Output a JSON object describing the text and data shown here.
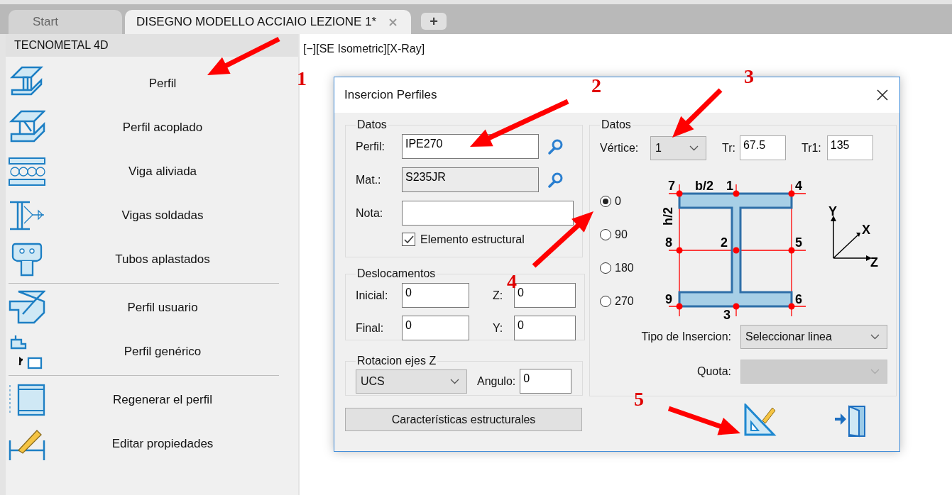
{
  "tabs": [
    {
      "label": "Start",
      "selected": false
    },
    {
      "label": "DISEGNO MODELLO ACCIAIO LEZIONE 1*",
      "selected": true
    }
  ],
  "new_tab": "+",
  "panel": {
    "title": "TECNOMETAL 4D",
    "groups": [
      [
        {
          "label": "Perfil",
          "kind": "beam"
        },
        {
          "label": "Perfil acoplado",
          "kind": "double"
        },
        {
          "label": "Viga aliviada",
          "kind": "castellated"
        },
        {
          "label": "Vigas soldadas",
          "kind": "welded"
        },
        {
          "label": "Tubos aplastados",
          "kind": "tube"
        }
      ],
      [
        {
          "label": "Perfil usuario",
          "kind": "user"
        },
        {
          "label": "Perfil genérico",
          "kind": "generic"
        }
      ],
      [
        {
          "label": "Regenerar el perfil",
          "kind": "regen"
        },
        {
          "label": "Editar propiedades",
          "kind": "edit"
        }
      ]
    ]
  },
  "viewport": {
    "label": "[−][SE Isometric][X-Ray]"
  },
  "dialog": {
    "title": "Insercion Perfiles",
    "datos": {
      "legend": "Datos",
      "perfil": {
        "label": "Perfil:",
        "value": "IPE270"
      },
      "material": {
        "label": "Mat.:",
        "value": "S235JR"
      },
      "nota": {
        "label": "Nota:"
      },
      "structural": {
        "label": "Elemento estructural",
        "checked": true
      }
    },
    "deslocamentos": {
      "legend": "Deslocamentos",
      "fields": [
        {
          "label": "Inicial:",
          "value": "0"
        },
        {
          "label": "Z:",
          "value": "0"
        },
        {
          "label": "Final:",
          "value": "0"
        },
        {
          "label": "Y:",
          "value": "0"
        }
      ]
    },
    "rotacion": {
      "legend": "Rotacion ejes Z",
      "select": "UCS",
      "angulo": {
        "label": "Angulo:",
        "value": "0"
      }
    },
    "characteristics_button": "Características estructurales",
    "right": {
      "legend": "Datos",
      "vertice": {
        "label": "Vértice:",
        "value": "1"
      },
      "tr": {
        "label": "Tr:",
        "value": "67.5"
      },
      "tr1": {
        "label": "Tr1:",
        "value": "135"
      },
      "orientations": [
        {
          "label": "0",
          "selected": true
        },
        {
          "label": "90",
          "selected": false
        },
        {
          "label": "180",
          "selected": false
        },
        {
          "label": "270",
          "selected": false
        }
      ],
      "diagram_labels": [
        "7",
        "b/2",
        "1",
        "4",
        "h/2",
        "8",
        "2",
        "5",
        "9",
        "6",
        "3"
      ],
      "axes": {
        "y": "Y",
        "x": "X",
        "z": "Z"
      },
      "tipo": {
        "label": "Tipo de Insercion:",
        "value": "Seleccionar linea"
      },
      "quota": {
        "label": "Quota:",
        "disabled": true
      }
    }
  },
  "annotations": [
    {
      "number": "1"
    },
    {
      "number": "2"
    },
    {
      "number": "3"
    },
    {
      "number": "4"
    },
    {
      "number": "5"
    }
  ]
}
